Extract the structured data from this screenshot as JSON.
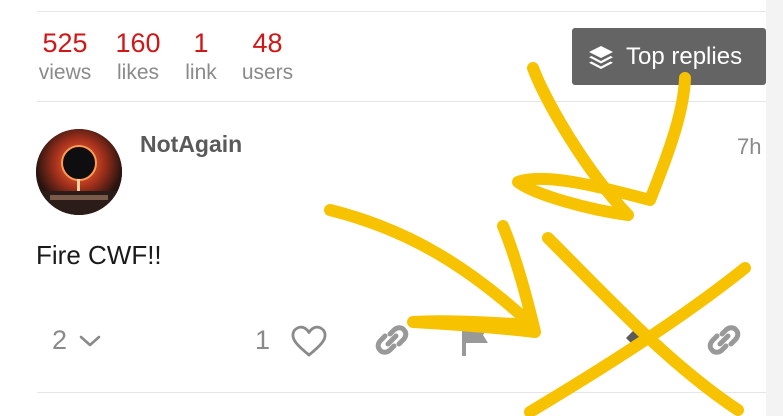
{
  "topic_stats": [
    {
      "number": "525",
      "label": "views"
    },
    {
      "number": "160",
      "label": "likes"
    },
    {
      "number": "1",
      "label": "link"
    },
    {
      "number": "48",
      "label": "users"
    }
  ],
  "top_replies_button": {
    "label": "Top replies",
    "icon": "layers-icon"
  },
  "post": {
    "username": "NotAgain",
    "time": "7h",
    "body": "Fire CWF!!",
    "reply_count": "2",
    "like_count": "1"
  },
  "colors": {
    "stat_number": "#d01717",
    "button_bg": "#646464",
    "scribble": "#f7c200"
  }
}
